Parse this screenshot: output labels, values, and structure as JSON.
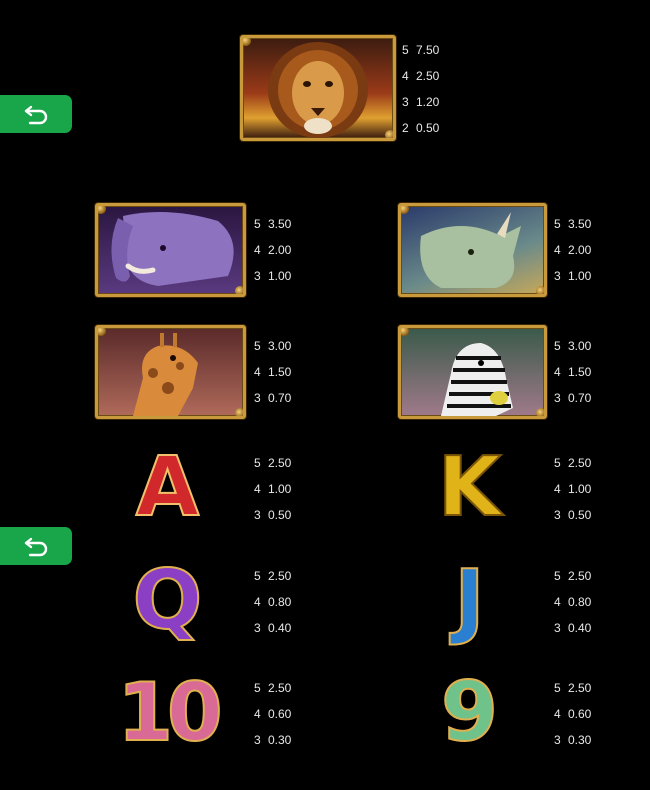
{
  "back_buttons": [
    {
      "icon": "undo-arrow-icon",
      "color": "#19a64a"
    },
    {
      "icon": "undo-arrow-icon",
      "color": "#19a64a"
    }
  ],
  "symbols": [
    {
      "id": "lion",
      "icon": "lion-icon",
      "pays": [
        {
          "count": "5",
          "value": "7.50"
        },
        {
          "count": "4",
          "value": "2.50"
        },
        {
          "count": "3",
          "value": "1.20"
        },
        {
          "count": "2",
          "value": "0.50"
        }
      ]
    },
    {
      "id": "elephant",
      "icon": "elephant-icon",
      "pays": [
        {
          "count": "5",
          "value": "3.50"
        },
        {
          "count": "4",
          "value": "2.00"
        },
        {
          "count": "3",
          "value": "1.00"
        }
      ]
    },
    {
      "id": "rhino",
      "icon": "rhino-icon",
      "pays": [
        {
          "count": "5",
          "value": "3.50"
        },
        {
          "count": "4",
          "value": "2.00"
        },
        {
          "count": "3",
          "value": "1.00"
        }
      ]
    },
    {
      "id": "giraffe",
      "icon": "giraffe-icon",
      "pays": [
        {
          "count": "5",
          "value": "3.00"
        },
        {
          "count": "4",
          "value": "1.50"
        },
        {
          "count": "3",
          "value": "0.70"
        }
      ]
    },
    {
      "id": "zebra",
      "icon": "zebra-icon",
      "pays": [
        {
          "count": "5",
          "value": "3.00"
        },
        {
          "count": "4",
          "value": "1.50"
        },
        {
          "count": "3",
          "value": "0.70"
        }
      ]
    },
    {
      "id": "a",
      "label": "A",
      "pays": [
        {
          "count": "5",
          "value": "2.50"
        },
        {
          "count": "4",
          "value": "1.00"
        },
        {
          "count": "3",
          "value": "0.50"
        }
      ]
    },
    {
      "id": "k",
      "label": "K",
      "pays": [
        {
          "count": "5",
          "value": "2.50"
        },
        {
          "count": "4",
          "value": "1.00"
        },
        {
          "count": "3",
          "value": "0.50"
        }
      ]
    },
    {
      "id": "q",
      "label": "Q",
      "pays": [
        {
          "count": "5",
          "value": "2.50"
        },
        {
          "count": "4",
          "value": "0.80"
        },
        {
          "count": "3",
          "value": "0.40"
        }
      ]
    },
    {
      "id": "j",
      "label": "J",
      "pays": [
        {
          "count": "5",
          "value": "2.50"
        },
        {
          "count": "4",
          "value": "0.80"
        },
        {
          "count": "3",
          "value": "0.40"
        }
      ]
    },
    {
      "id": "ten",
      "label": "10",
      "pays": [
        {
          "count": "5",
          "value": "2.50"
        },
        {
          "count": "4",
          "value": "0.60"
        },
        {
          "count": "3",
          "value": "0.30"
        }
      ]
    },
    {
      "id": "nine",
      "label": "9",
      "pays": [
        {
          "count": "5",
          "value": "2.50"
        },
        {
          "count": "4",
          "value": "0.60"
        },
        {
          "count": "3",
          "value": "0.30"
        }
      ]
    }
  ],
  "colors": {
    "background": "#000000",
    "frame_gold": "#c89a3c",
    "button_green": "#19a64a",
    "letter_a": "#d1282b",
    "letter_k": "#e0b318",
    "letter_q": "#8b3fc4",
    "letter_j": "#2a7fd0",
    "letter_10": "#d86a95",
    "letter_9": "#6fc28a"
  }
}
